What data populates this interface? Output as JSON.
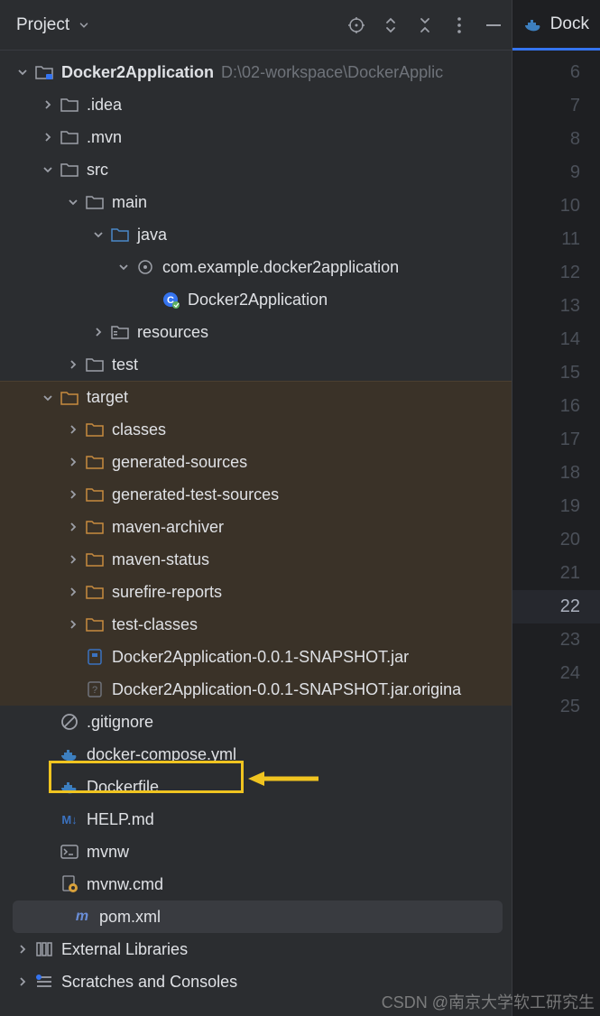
{
  "header": {
    "title": "Project"
  },
  "project": {
    "root": "Docker2Application",
    "root_path": "D:\\02-workspace\\DockerApplic",
    "idea": ".idea",
    "mvn": ".mvn",
    "src": "src",
    "main": "main",
    "java": "java",
    "package": "com.example.docker2application",
    "app_class": "Docker2Application",
    "resources": "resources",
    "test": "test",
    "target": "target",
    "classes": "classes",
    "gen_sources": "generated-sources",
    "gen_test_sources": "generated-test-sources",
    "maven_archiver": "maven-archiver",
    "maven_status": "maven-status",
    "surefire": "surefire-reports",
    "test_classes": "test-classes",
    "jar": "Docker2Application-0.0.1-SNAPSHOT.jar",
    "jar_original": "Docker2Application-0.0.1-SNAPSHOT.jar.origina",
    "gitignore": ".gitignore",
    "docker_compose": "docker-compose.yml",
    "dockerfile": "Dockerfile",
    "help_md": "HELP.md",
    "mvnw": "mvnw",
    "mvnw_cmd": "mvnw.cmd",
    "pom": "pom.xml",
    "external_libs": "External Libraries",
    "scratches": "Scratches and Consoles"
  },
  "editor": {
    "tab_label": "Dock",
    "line_numbers": [
      6,
      7,
      8,
      9,
      10,
      11,
      12,
      13,
      14,
      15,
      16,
      17,
      18,
      19,
      20,
      21,
      22,
      23,
      24,
      25
    ],
    "active_line": 22
  },
  "watermark": "CSDN @南京大学软工研究生"
}
